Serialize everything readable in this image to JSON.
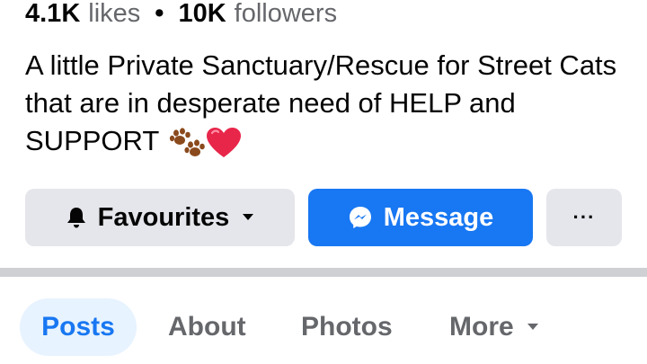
{
  "stats": {
    "likes_count": "4.1K",
    "likes_label": "likes",
    "separator": "•",
    "followers_count": "10K",
    "followers_label": "followers"
  },
  "bio": {
    "text": "A little Private Sanctuary/Rescue for Street Cats that are in desperate need of HELP and SUPPORT",
    "emojis": [
      "paw-prints",
      "red-heart"
    ]
  },
  "actions": {
    "favourites_label": "Favourites",
    "message_label": "Message",
    "more_label": "···"
  },
  "tabs": [
    {
      "label": "Posts",
      "active": true
    },
    {
      "label": "About",
      "active": false
    },
    {
      "label": "Photos",
      "active": false
    },
    {
      "label": "More",
      "active": false
    }
  ],
  "colors": {
    "accent": "#1877f2",
    "active_tab_bg": "#e7f3ff",
    "secondary_button_bg": "#e4e6eb",
    "muted_text": "#65676b",
    "divider": "#ced0d4"
  }
}
